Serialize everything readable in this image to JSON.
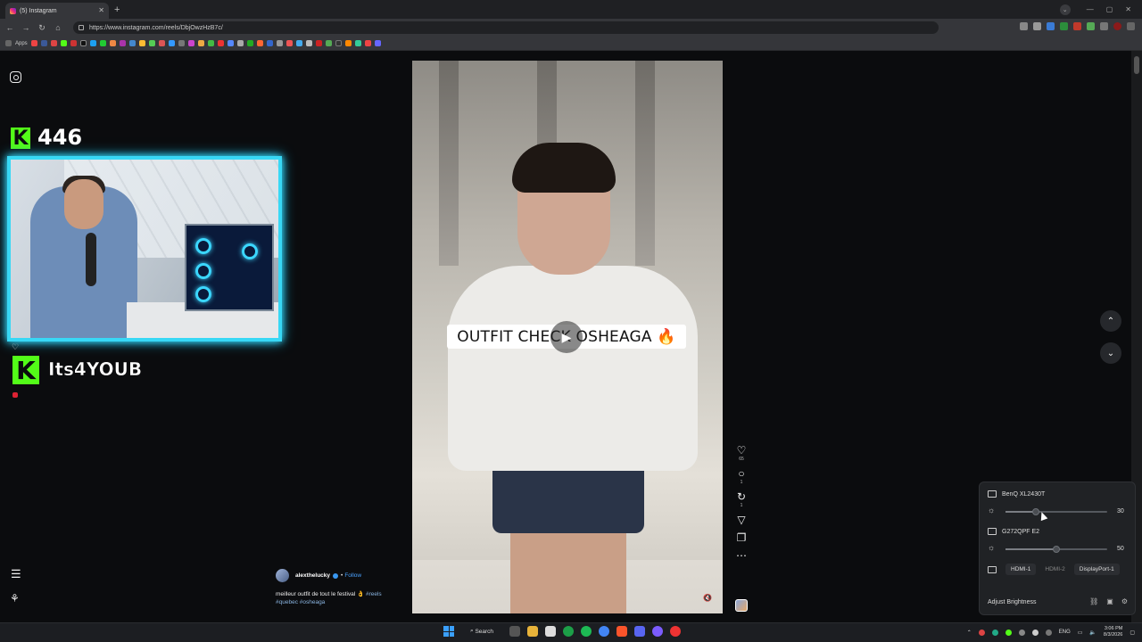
{
  "browser": {
    "tab_title": "(5) Instagram",
    "new_tab": "+",
    "url": "https://www.instagram.com/reels/DbjOwzHzB7c/",
    "bookmarks_label": "Apps"
  },
  "stream": {
    "viewer_count": "446",
    "streamer_name": "Its4YOUB"
  },
  "reel": {
    "caption_text": "OUTFIT CHECK OSHEAGA 🔥",
    "author": "alexthelucky",
    "follow_label": "Follow",
    "description": "meilleur outfit de tout le festival 👌",
    "tags_line1": "#reels",
    "tags_line2": "#quebec #osheaga",
    "likes": "65",
    "comments": "1",
    "reposts": "1"
  },
  "icons": {
    "play": "▶",
    "heart": "♡",
    "comment": "○",
    "repost": "↻",
    "send": "▽",
    "bookmark": "❐",
    "more": "⋯",
    "menu": "☰",
    "up": "⌃",
    "down": "⌄",
    "mute": "🔇"
  },
  "brightness": {
    "monitors": [
      {
        "name": "BenQ XL2430T",
        "value": "30",
        "level": 0.3
      },
      {
        "name": "G272QPF E2",
        "value": "50",
        "level": 0.5
      }
    ],
    "inputs": [
      "HDMI-1",
      "HDMI-2",
      "DisplayPort-1"
    ],
    "adjust_label": "Adjust Brightness"
  },
  "taskbar": {
    "search_label": "Search",
    "lang": "ENG",
    "time": "3:06 PM",
    "date": "8/3/2026"
  },
  "colors": {
    "kick_green": "#53fc18",
    "webcam_border": "#38d8f5",
    "ig_link": "#4aa3ff"
  }
}
